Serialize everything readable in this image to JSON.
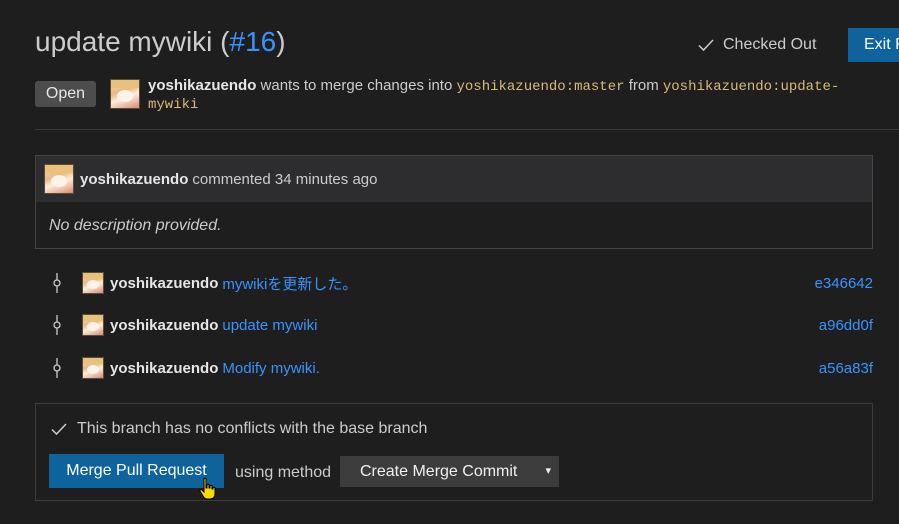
{
  "header": {
    "title": "update mywiki",
    "pr_number": "#16",
    "checked_out_label": "Checked Out",
    "exit_label": "Exit P"
  },
  "status": {
    "badge": "Open"
  },
  "merge_info": {
    "author": "yoshikazuendo",
    "text_wants": "wants to merge changes  into",
    "target_branch": "yoshikazuendo:master",
    "text_from": "from",
    "source_branch_part1": "yoshikazuendo:update-",
    "source_branch_part2": "mywiki"
  },
  "comment": {
    "author": "yoshikazuendo",
    "meta": "commented 34 minutes ago",
    "body": "No description provided."
  },
  "commits": [
    {
      "author": "yoshikazuendo",
      "message": "mywikiを更新した。",
      "sha": "e346642"
    },
    {
      "author": "yoshikazuendo",
      "message": "update mywiki",
      "sha": "a96dd0f"
    },
    {
      "author": "yoshikazuendo",
      "message": "Modify mywiki.",
      "sha": "a56a83f"
    }
  ],
  "merge": {
    "status_text": "This branch has no conflicts with the base branch",
    "button_label": "Merge Pull Request",
    "using_method": "using method",
    "method_selected": "Create Merge Commit",
    "caret": "▾"
  },
  "colors": {
    "background": "#1e1e1e",
    "accent_blue": "#0e639c",
    "link_blue": "#3794ff",
    "branch_yellow": "#d7ba7d"
  }
}
